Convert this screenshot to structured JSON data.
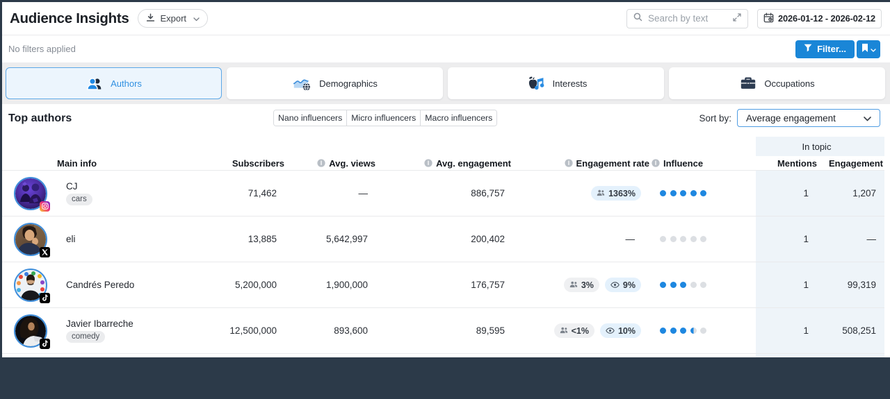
{
  "header": {
    "title": "Audience Insights",
    "export_label": "Export",
    "search_placeholder": "Search by text",
    "date_range": "2026-01-12 - 2026-02-12"
  },
  "filter_bar": {
    "status": "No filters applied",
    "filter_label": "Filter..."
  },
  "tabs": [
    {
      "label": "Authors",
      "active": true
    },
    {
      "label": "Demographics",
      "active": false
    },
    {
      "label": "Interests",
      "active": false
    },
    {
      "label": "Occupations",
      "active": false
    }
  ],
  "content": {
    "heading": "Top authors",
    "segments": [
      {
        "label": "Nano influencers"
      },
      {
        "label": "Micro influencers"
      },
      {
        "label": "Macro influencers"
      }
    ],
    "sort_label": "Sort by:",
    "sort_value": "Average engagement"
  },
  "table": {
    "group_header": "In topic",
    "columns": {
      "main": "Main info",
      "subscribers": "Subscribers",
      "avg_views": "Avg. views",
      "avg_engagement": "Avg. engagement",
      "engagement_rate": "Engagement rate",
      "influence": "Influence",
      "mentions": "Mentions",
      "in_topic_engagement": "Engagement"
    },
    "rows": [
      {
        "name": "CJ",
        "tag": "cars",
        "network": "instagram",
        "subscribers": "71,462",
        "avg_views": "—",
        "avg_engagement": "886,757",
        "rates": [
          {
            "icon": "people",
            "value": "1363%",
            "style": "blue"
          }
        ],
        "influence": 5,
        "mentions": "1",
        "in_topic_engagement": "1,207"
      },
      {
        "name": "eli",
        "tag": null,
        "network": "x",
        "subscribers": "13,885",
        "avg_views": "5,642,997",
        "avg_engagement": "200,402",
        "rates_placeholder": "—",
        "influence": 0,
        "mentions": "1",
        "in_topic_engagement": "—"
      },
      {
        "name": "Candrés Peredo",
        "tag": null,
        "network": "tiktok",
        "subscribers": "5,200,000",
        "avg_views": "1,900,000",
        "avg_engagement": "176,757",
        "rates": [
          {
            "icon": "people",
            "value": "3%",
            "style": "gray"
          },
          {
            "icon": "eye",
            "value": "9%",
            "style": "blue"
          }
        ],
        "influence": 3,
        "mentions": "1",
        "in_topic_engagement": "99,319"
      },
      {
        "name": "Javier Ibarreche",
        "tag": "comedy",
        "network": "tiktok",
        "subscribers": "12,500,000",
        "avg_views": "893,600",
        "avg_engagement": "89,595",
        "rates": [
          {
            "icon": "people",
            "value": "<1%",
            "style": "gray"
          },
          {
            "icon": "eye",
            "value": "10%",
            "style": "blue"
          }
        ],
        "influence": 3.5,
        "mentions": "1",
        "in_topic_engagement": "508,251"
      }
    ]
  },
  "icons": {
    "export": "download-icon",
    "search": "search-icon",
    "search_expand": "expand-icon",
    "date": "calendar-icon",
    "filter": "funnel-icon",
    "saved_filters": "bookmark-icon",
    "column_hint": "info-icon",
    "rate_subscribers": "people-icon",
    "rate_views": "eye-icon"
  },
  "colors": {
    "accent_blue": "#1a86d7",
    "active_tab_blue": "#3090e1",
    "influence_dot_blue": "#1e87e0",
    "in_topic_tint": "#eef4f9",
    "frame_dark": "#2c3a49"
  }
}
